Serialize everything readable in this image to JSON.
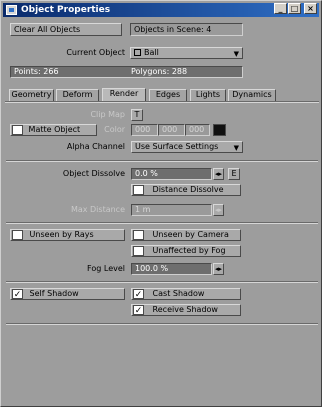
{
  "window": {
    "title": "Object Properties",
    "min_glyph": "_",
    "max_glyph": "□",
    "close_glyph": "×"
  },
  "top": {
    "clear_all_label": "Clear All Objects",
    "objects_in_scene": "Objects in Scene: 4",
    "current_object_label": "Current Object",
    "current_object_value": "Ball",
    "points": "Points: 266",
    "polygons": "Polygons: 288"
  },
  "tabs": [
    {
      "label": "Geometry"
    },
    {
      "label": "Deform"
    },
    {
      "label": "Render",
      "active": true
    },
    {
      "label": "Edges"
    },
    {
      "label": "Lights"
    },
    {
      "label": "Dynamics"
    }
  ],
  "render": {
    "clip_map_label": "Clip Map",
    "clip_map_button": "T",
    "matte_object_label": "Matte Object",
    "color_label": "Color",
    "color_r": "000",
    "color_g": "000",
    "color_b": "000",
    "alpha_channel_label": "Alpha Channel",
    "alpha_channel_value": "Use Surface Settings",
    "object_dissolve_label": "Object Dissolve",
    "object_dissolve_value": "0.0 %",
    "envelope_button": "E",
    "distance_dissolve_label": "Distance Dissolve",
    "max_distance_label": "Max Distance",
    "max_distance_value": "1 m",
    "unseen_by_rays": "Unseen by Rays",
    "unseen_by_camera": "Unseen by Camera",
    "unaffected_by_fog": "Unaffected by Fog",
    "fog_level_label": "Fog Level",
    "fog_level_value": "100.0 %",
    "self_shadow": "Self Shadow",
    "cast_shadow": "Cast Shadow",
    "receive_shadow": "Receive Shadow",
    "check_glyph": "✓"
  },
  "colors": {
    "title_bar_start": "#0a2a6b",
    "title_bar_end": "#2f6fc6",
    "panel": "#9d9d9d",
    "field": "#6e6e6e"
  }
}
